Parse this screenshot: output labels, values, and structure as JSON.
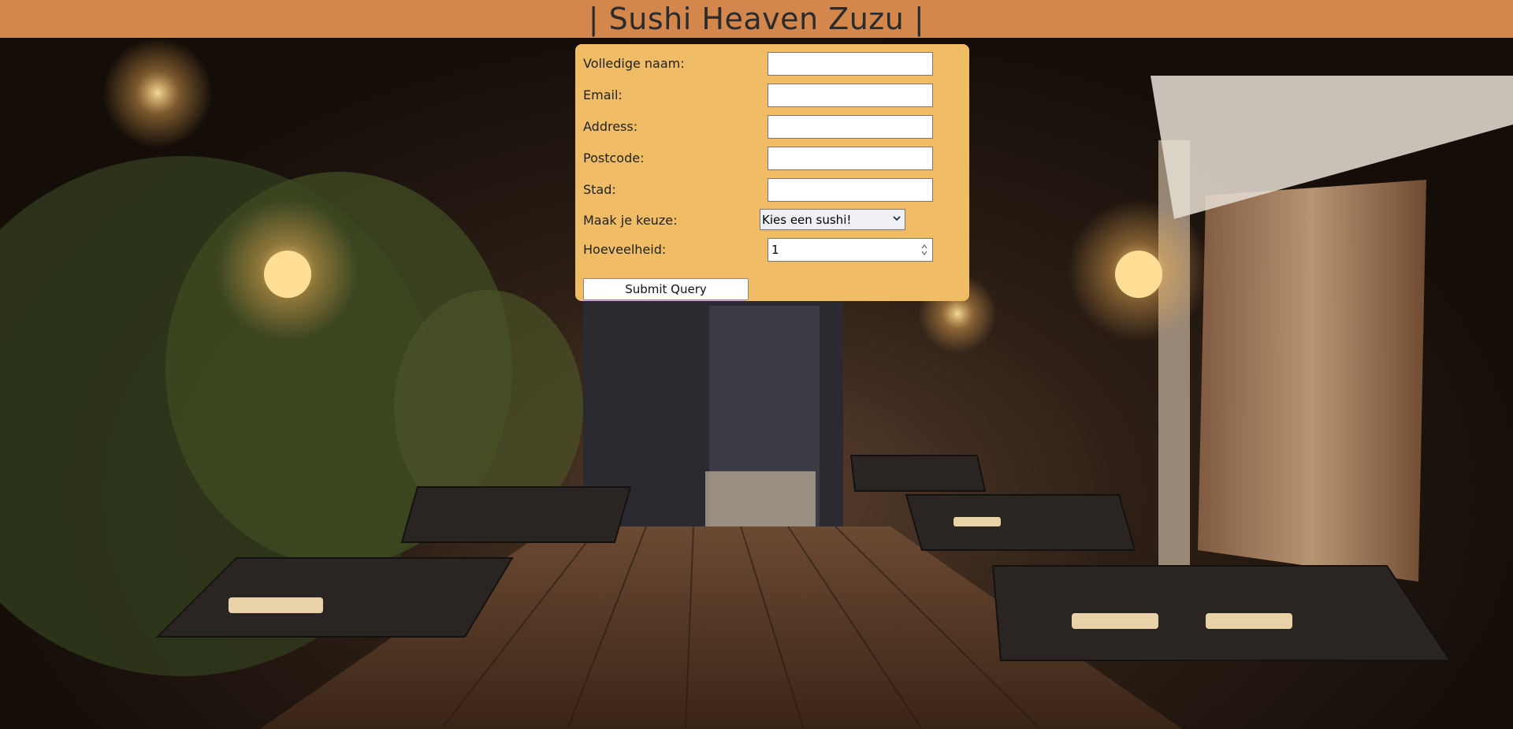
{
  "header": {
    "title": "| Sushi Heaven Zuzu |"
  },
  "form": {
    "fields": [
      {
        "label": "Volledige naam:",
        "value": ""
      },
      {
        "label": "Email:",
        "value": ""
      },
      {
        "label": "Address:",
        "value": ""
      },
      {
        "label": "Postcode:",
        "value": ""
      },
      {
        "label": "Stad:",
        "value": ""
      }
    ],
    "choice": {
      "label": "Maak je keuze:",
      "selected": "Kies een sushi!"
    },
    "quantity": {
      "label": "Hoeveelheid:",
      "value": "1"
    },
    "submit_label": "Submit Query"
  },
  "colors": {
    "header_bg": "#d4874c",
    "form_bg": "#f0bd66"
  },
  "background": {
    "description_icon": "restaurant-photo"
  }
}
